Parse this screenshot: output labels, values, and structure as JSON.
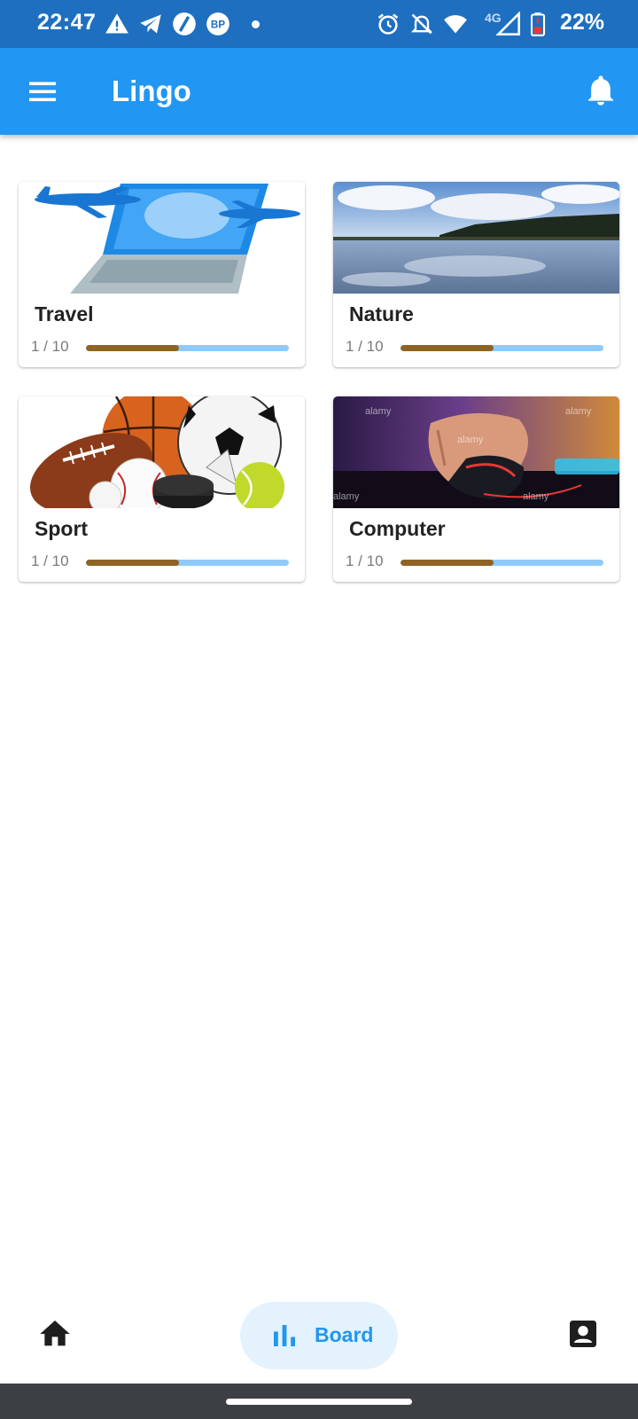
{
  "status_bar": {
    "time": "22:47",
    "network": "4G",
    "battery": "22%",
    "icons": [
      "warning-icon",
      "telegram-icon",
      "vpn-icon",
      "bp-icon",
      "alarm-icon",
      "mute-icon",
      "wifi-icon",
      "signal-icon",
      "battery-icon"
    ]
  },
  "app_bar": {
    "title": "Lingo",
    "menu_icon": "hamburger-menu-icon",
    "notification_icon": "bell-icon"
  },
  "categories": [
    {
      "label": "Travel",
      "count": "1 / 10",
      "progress": 0.46,
      "image": "laptop-airplanes"
    },
    {
      "label": "Nature",
      "count": "1 / 10",
      "progress": 0.46,
      "image": "lake-sky"
    },
    {
      "label": "Sport",
      "count": "1 / 10",
      "progress": 0.46,
      "image": "sports-balls"
    },
    {
      "label": "Computer",
      "count": "1 / 10",
      "progress": 0.46,
      "image": "gaming-mouse"
    }
  ],
  "bottom_nav": {
    "home_icon": "home-icon",
    "board_label": "Board",
    "board_icon": "bar-chart-icon",
    "profile_icon": "contact-icon"
  },
  "colors": {
    "status_bar": "#1f6fc0",
    "app_bar": "#2196f3",
    "progress_fill": "#8e6424",
    "progress_track": "#90caf9",
    "board_pill": "#e3f2fd"
  }
}
